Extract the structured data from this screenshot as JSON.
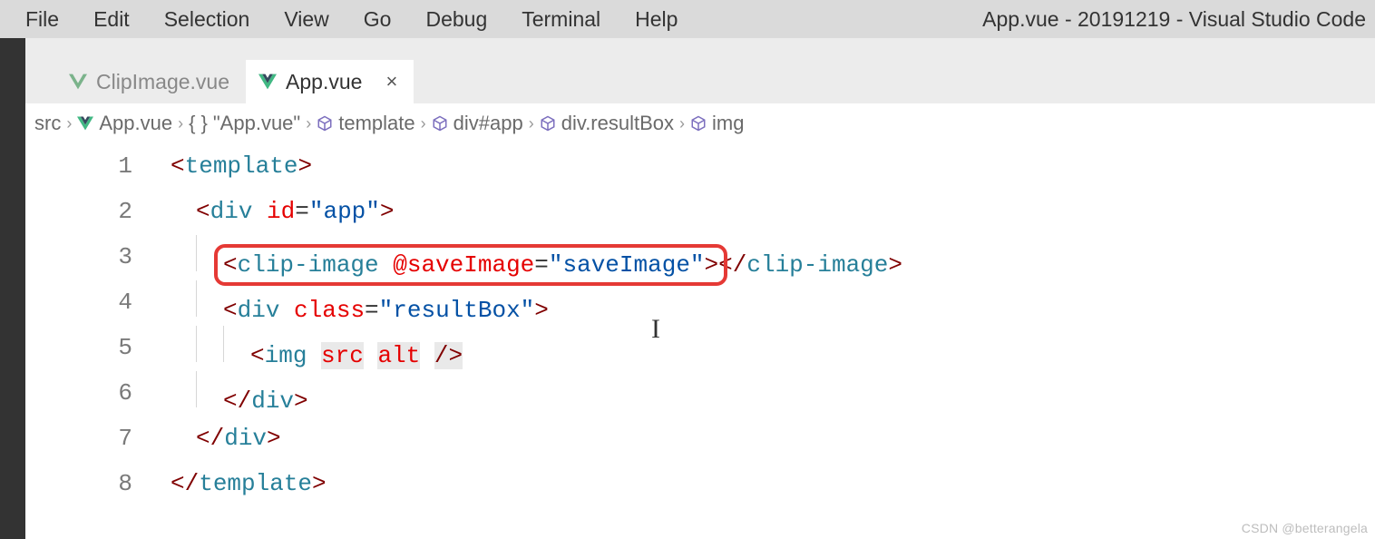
{
  "menu": {
    "items": [
      "File",
      "Edit",
      "Selection",
      "View",
      "Go",
      "Debug",
      "Terminal",
      "Help"
    ],
    "title": "App.vue - 20191219 - Visual Studio Code"
  },
  "tabs": [
    {
      "label": "ClipImage.vue",
      "active": false
    },
    {
      "label": "App.vue",
      "active": true
    }
  ],
  "breadcrumbs": {
    "src": "src",
    "file": "App.vue",
    "scope": "\"App.vue\"",
    "nodes": [
      "template",
      "div#app",
      "div.resultBox",
      "img"
    ]
  },
  "code": {
    "lines": [
      {
        "n": 1,
        "indent": 0,
        "segments": [
          {
            "t": "<",
            "c": "punct"
          },
          {
            "t": "template",
            "c": "tagname"
          },
          {
            "t": ">",
            "c": "punct"
          }
        ]
      },
      {
        "n": 2,
        "indent": 1,
        "segments": [
          {
            "t": "<",
            "c": "punct"
          },
          {
            "t": "div ",
            "c": "tagname"
          },
          {
            "t": "id",
            "c": "attr"
          },
          {
            "t": "=",
            "c": "eq"
          },
          {
            "t": "\"app\"",
            "c": "str"
          },
          {
            "t": ">",
            "c": "punct"
          }
        ]
      },
      {
        "n": 3,
        "indent": 2,
        "segments": [
          {
            "t": "<",
            "c": "punct"
          },
          {
            "t": "clip-image ",
            "c": "tagname"
          },
          {
            "t": "@saveImage",
            "c": "evt"
          },
          {
            "t": "=",
            "c": "eq"
          },
          {
            "t": "\"saveImage\"",
            "c": "str"
          },
          {
            "t": ">",
            "c": "punct"
          },
          {
            "t": "</",
            "c": "punct"
          },
          {
            "t": "clip-image",
            "c": "tagname"
          },
          {
            "t": ">",
            "c": "punct"
          }
        ]
      },
      {
        "n": 4,
        "indent": 2,
        "segments": [
          {
            "t": "<",
            "c": "punct"
          },
          {
            "t": "div ",
            "c": "tagname"
          },
          {
            "t": "class",
            "c": "attr"
          },
          {
            "t": "=",
            "c": "eq"
          },
          {
            "t": "\"resultBox\"",
            "c": "str"
          },
          {
            "t": ">",
            "c": "punct"
          }
        ]
      },
      {
        "n": 5,
        "indent": 3,
        "segments": [
          {
            "t": "<",
            "c": "punct"
          },
          {
            "t": "img ",
            "c": "tagname"
          },
          {
            "t": "src",
            "c": "attr emptyattr"
          },
          {
            "t": " ",
            "c": ""
          },
          {
            "t": "alt",
            "c": "attr emptyattr"
          },
          {
            "t": " ",
            "c": ""
          },
          {
            "t": "/>",
            "c": "punct emptyattr"
          }
        ]
      },
      {
        "n": 6,
        "indent": 2,
        "segments": [
          {
            "t": "</",
            "c": "punct"
          },
          {
            "t": "div",
            "c": "tagname"
          },
          {
            "t": ">",
            "c": "punct"
          }
        ]
      },
      {
        "n": 7,
        "indent": 1,
        "segments": [
          {
            "t": "</",
            "c": "punct"
          },
          {
            "t": "div",
            "c": "tagname"
          },
          {
            "t": ">",
            "c": "punct"
          }
        ]
      },
      {
        "n": 8,
        "indent": 0,
        "segments": [
          {
            "t": "</",
            "c": "punct"
          },
          {
            "t": "template",
            "c": "tagname"
          },
          {
            "t": ">",
            "c": "punct"
          }
        ]
      }
    ]
  },
  "highlight": {
    "lineIndex": 2
  },
  "watermark": "CSDN @betterangela"
}
